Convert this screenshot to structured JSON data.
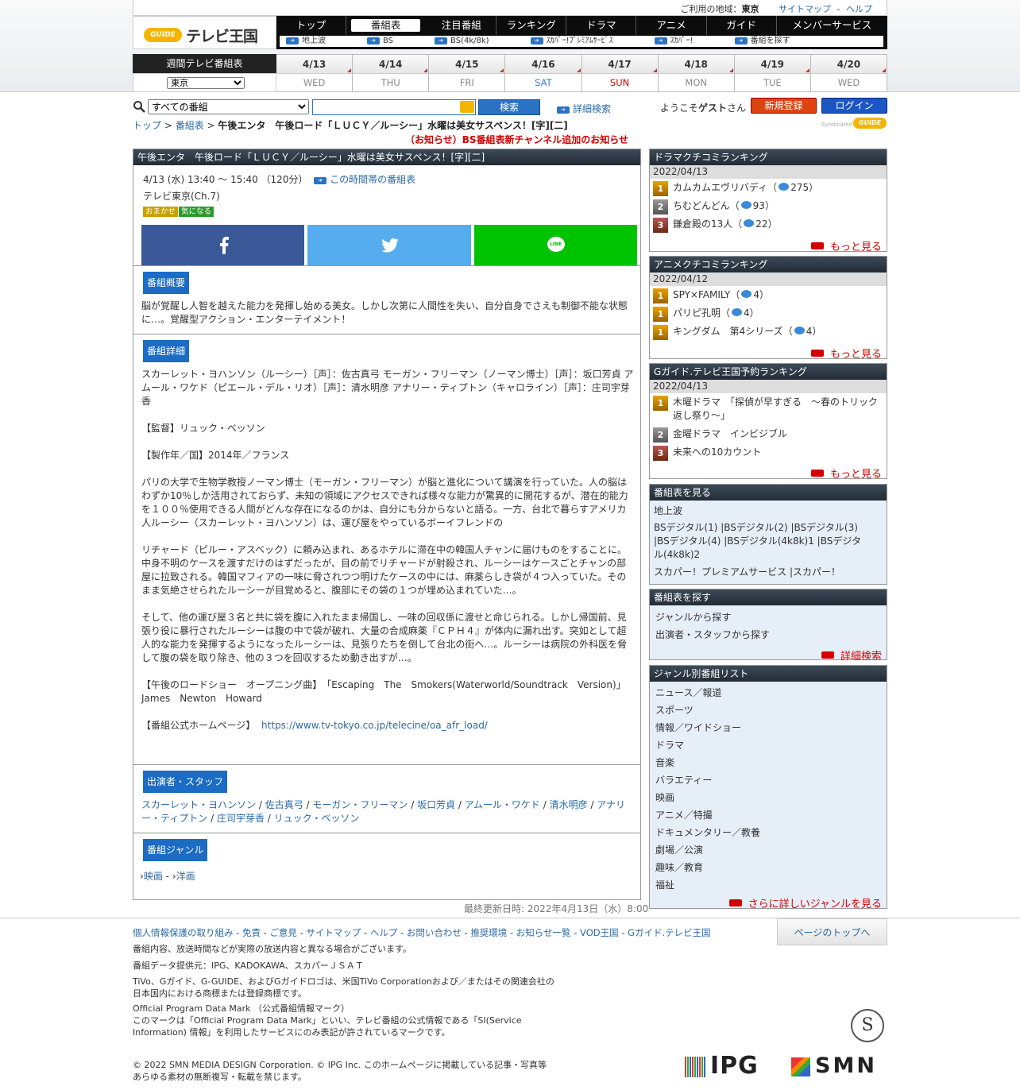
{
  "header": {
    "area_label": "ご利用の地域：",
    "area": "東京",
    "sitemap": "サイトマップ",
    "help": "ヘルプ",
    "sep": "-",
    "logo_g": "GUIDE",
    "logo_text": "テレビ王国",
    "nav": [
      "トップ",
      "番組表",
      "注目番組",
      "ランキング",
      "ドラマ",
      "アニメ",
      "ガイド",
      "メンバーサービス"
    ],
    "subnav": [
      "地上波",
      "BS",
      "BS(4k/8k)",
      "ｽｶﾊﾟｰ!ﾌﾟﾚﾐｱﾑｻｰﾋﾞｽ",
      "ｽｶﾊﾟｰ!",
      "番組を探す"
    ]
  },
  "week": {
    "title": "週間テレビ番組表",
    "region": "東京",
    "days": [
      {
        "date": "4/13",
        "dow": "WED"
      },
      {
        "date": "4/14",
        "dow": "THU"
      },
      {
        "date": "4/15",
        "dow": "FRI"
      },
      {
        "date": "4/16",
        "dow": "SAT"
      },
      {
        "date": "4/17",
        "dow": "SUN"
      },
      {
        "date": "4/18",
        "dow": "MON"
      },
      {
        "date": "4/19",
        "dow": "TUE"
      },
      {
        "date": "4/20",
        "dow": "WED"
      }
    ],
    "sat_color": "#3a7ad4",
    "sun_color": "#d40000"
  },
  "search": {
    "category": "すべての番組",
    "button": "検索",
    "advanced": "詳細検索",
    "welcome_pre": "ようこそ",
    "guest": "ゲスト",
    "welcome_post": "さん",
    "register": "新規登録",
    "login": "ログイン"
  },
  "breadcrumb": {
    "top": "トップ",
    "sep": " > ",
    "schedule": "番組表",
    "current": "午後エンタ　午後ロード「ＬＵＣＹ／ルーシー」水曜は美女サスペンス！[字][二]"
  },
  "syndicated": "Syndicated",
  "syn_g": "GUIDE",
  "notice": "（お知らせ）BS番組表新チャンネル追加のお知らせ",
  "program": {
    "title": "午後エンタ　午後ロード「ＬＵＣＹ／ルーシー」水曜は美女サスペンス！[字][二]",
    "datetime": "4/13 (水) 13:40 ～ 15:40 （120分）",
    "timeslot_link": "この時間帯の番組表",
    "channel": "テレビ東京(Ch.7)",
    "tags": [
      {
        "label": "おまかせ",
        "color": "#c8a000"
      },
      {
        "label": "気になる",
        "color": "#2a9a2a"
      }
    ],
    "social": [
      {
        "name": "facebook",
        "color": "#3b5998"
      },
      {
        "name": "twitter",
        "color": "#55acee"
      },
      {
        "name": "line",
        "color": "#00c300"
      }
    ],
    "line_label": "LINE",
    "summary_head": "番組概要",
    "summary": "脳が覚醒し人智を越えた能力を発揮し始める美女。しかし次第に人間性を失い、自分自身でさえも制御不能な状態に…。覚醒型アクション・エンターテイメント！",
    "detail_head": "番組詳細",
    "detail": [
      "スカーレット・ヨハンソン（ルーシー）［声］：佐古真弓 モーガン・フリーマン（ノーマン博士）［声］：坂口芳貞 アムール・ワケド（ピエール・デル・リオ）［声］：清水明彦 アナリー・ティプトン（キャロライン）［声］：庄司宇芽香",
      "【監督】リュック・ベッソン",
      "【製作年／国】2014年／フランス",
      "パリの大学で生物学教授ノーマン博士（モーガン・フリーマン）が脳と進化について講演を行っていた。人の脳はわずか10％しか活用されておらず、未知の領域にアクセスできれば様々な能力が驚異的に開花するが、潜在的能力を１００％使用できる人間がどんな存在になるのかは、自分にも分からないと語る。一方、台北で暮らすアメリカ人ルーシー（スカーレット・ヨハンソン）は、運び屋をやっているボーイフレンドの",
      "リチャード（ピルー・アスベック）に頼み込まれ、あるホテルに滞在中の韓国人チャンに届けものをすることに。中身不明のケースを渡すだけのはずだったが、目の前でリチャードが射殺され、ルーシーはケースごとチャンの部屋に拉致される。韓国マフィアの一味に脅されつつ明けたケースの中には、麻薬らしき袋が４つ入っていた。そのまま気絶させられたルーシーが目覚めると、腹部にその袋の１つが埋め込まれていた…。",
      "そして、他の運び屋３名と共に袋を腹に入れたまま帰国し、一味の回収係に渡せと命じられる。しかし帰国前、見張り役に暴行されたルーシーは腹の中で袋が破れ、大量の合成麻薬『ＣＰＨ４』が体内に漏れ出す。突如として超人的な能力を発揮するようになったルーシーは、見張りたちを倒して台北の街へ…。ルーシーは病院の外科医を脅して腹の袋を取り除き、他の３つを回収するため動き出すが…。",
      "【午後のロードショー　オープニング曲】　「Escaping　The　Smokers(Waterworld/Soundtrack　Version)」　James　Newton　Howard"
    ],
    "hp_label": "【番組公式ホームページ】",
    "hp_url": "https://www.tv-tokyo.co.jp/telecine/oa_afr_load/",
    "cast_head": "出演者・スタッフ",
    "cast": [
      "スカーレット・ヨハンソン",
      "佐古真弓",
      "モーガン・フリーマン",
      "坂口芳貞",
      "アムール・ワケド",
      "清水明彦",
      "アナリー・ティプトン",
      "庄司宇芽香",
      "リュック・ベッソン"
    ],
    "cast_sep": " / ",
    "genre_head": "番組ジャンル",
    "genres": [
      "映画",
      "洋画"
    ],
    "genre_sep": " - ",
    "updated": "最終更新日時: 2022年4月13日（水）8:00"
  },
  "sidebar": {
    "drama": {
      "title": "ドラマクチコミランキング",
      "date": "2022/04/13",
      "items": [
        {
          "rank": "1",
          "name": "カムカムエヴリバディ",
          "count": "275"
        },
        {
          "rank": "2",
          "name": "ちむどんどん",
          "count": "93"
        },
        {
          "rank": "3",
          "name": "鎌倉殿の13人",
          "count": "22"
        }
      ],
      "more": "もっと見る"
    },
    "anime": {
      "title": "アニメクチコミランキング",
      "date": "2022/04/12",
      "items": [
        {
          "rank": "1",
          "name": "SPY×FAMILY",
          "count": "4"
        },
        {
          "rank": "1",
          "name": "パリピ孔明",
          "count": "4"
        },
        {
          "rank": "1",
          "name": "キングダム　第4シリーズ",
          "count": "4"
        }
      ],
      "more": "もっと見る"
    },
    "reserve": {
      "title": "Gガイド.テレビ王国予約ランキング",
      "date": "2022/04/13",
      "items": [
        {
          "rank": "1",
          "name": "木曜ドラマ　「探偵が早すぎる　〜春のトリック返し祭り〜」"
        },
        {
          "rank": "2",
          "name": "金曜ドラマ　インビジブル"
        },
        {
          "rank": "3",
          "name": "未来への10カウント"
        }
      ],
      "more": "もっと見る"
    },
    "view": {
      "title": "番組表を見る",
      "terrestrial": "地上波",
      "bs": "BSデジタル(1) |BSデジタル(2) |BSデジタル(3) |BSデジタル(4) |BSデジタル(4k8k)1 |BSデジタル(4k8k)2",
      "skyp": "スカパー！プレミアムサービス |スカパー！"
    },
    "find": {
      "title": "番組表を探す",
      "items": [
        "ジャンルから探す",
        "出演者・スタッフから探す"
      ],
      "more": "詳細検索"
    },
    "genre": {
      "title": "ジャンル別番組リスト",
      "items": [
        "ニュース／報道",
        "スポーツ",
        "情報／ワイドショー",
        "ドラマ",
        "音楽",
        "バラエティー",
        "映画",
        "アニメ／特撮",
        "ドキュメンタリー／教養",
        "劇場／公演",
        "趣味／教育",
        "福祉"
      ],
      "more": "さらに詳しいジャンルを見る"
    }
  },
  "footer": {
    "links": [
      "個人情報保護の取り組み",
      "免責",
      "ご意見",
      "サイトマップ",
      "ヘルプ",
      "お問い合わせ",
      "推奨環境",
      "お知らせ一覧",
      "VOD王国",
      "Gガイド.テレビ王国"
    ],
    "link_sep": " - ",
    "page_top": "ページのトップへ",
    "note1": "番組内容、放送時間などが実際の放送内容と異なる場合がございます。",
    "note2": "番組データ提供元：IPG、KADOKAWA、スカパーＪＳＡＴ",
    "note3": "TiVo、Gガイド、G-GUIDE、およびGガイドロゴは、米国TiVo Corporationおよび／またはその関連会社の日本国内における商標または登録商標です。",
    "note4": "Official Program Data Mark （公式番組情報マーク）",
    "note5": "このマークは「Official Program Data Mark」といい、テレビ番組の公式情報である「SI(Service Information) 情報」を利用したサービスにのみ表記が許されているマークです。",
    "copyright": "© 2022 SMN MEDIA DESIGN Corporation. © IPG Inc. このホームページに掲載している記事・写真等 あらゆる素材の無断複写・転載を禁じます。",
    "ipg": "IPG",
    "smn": "SMN",
    "si_mark": "S"
  }
}
